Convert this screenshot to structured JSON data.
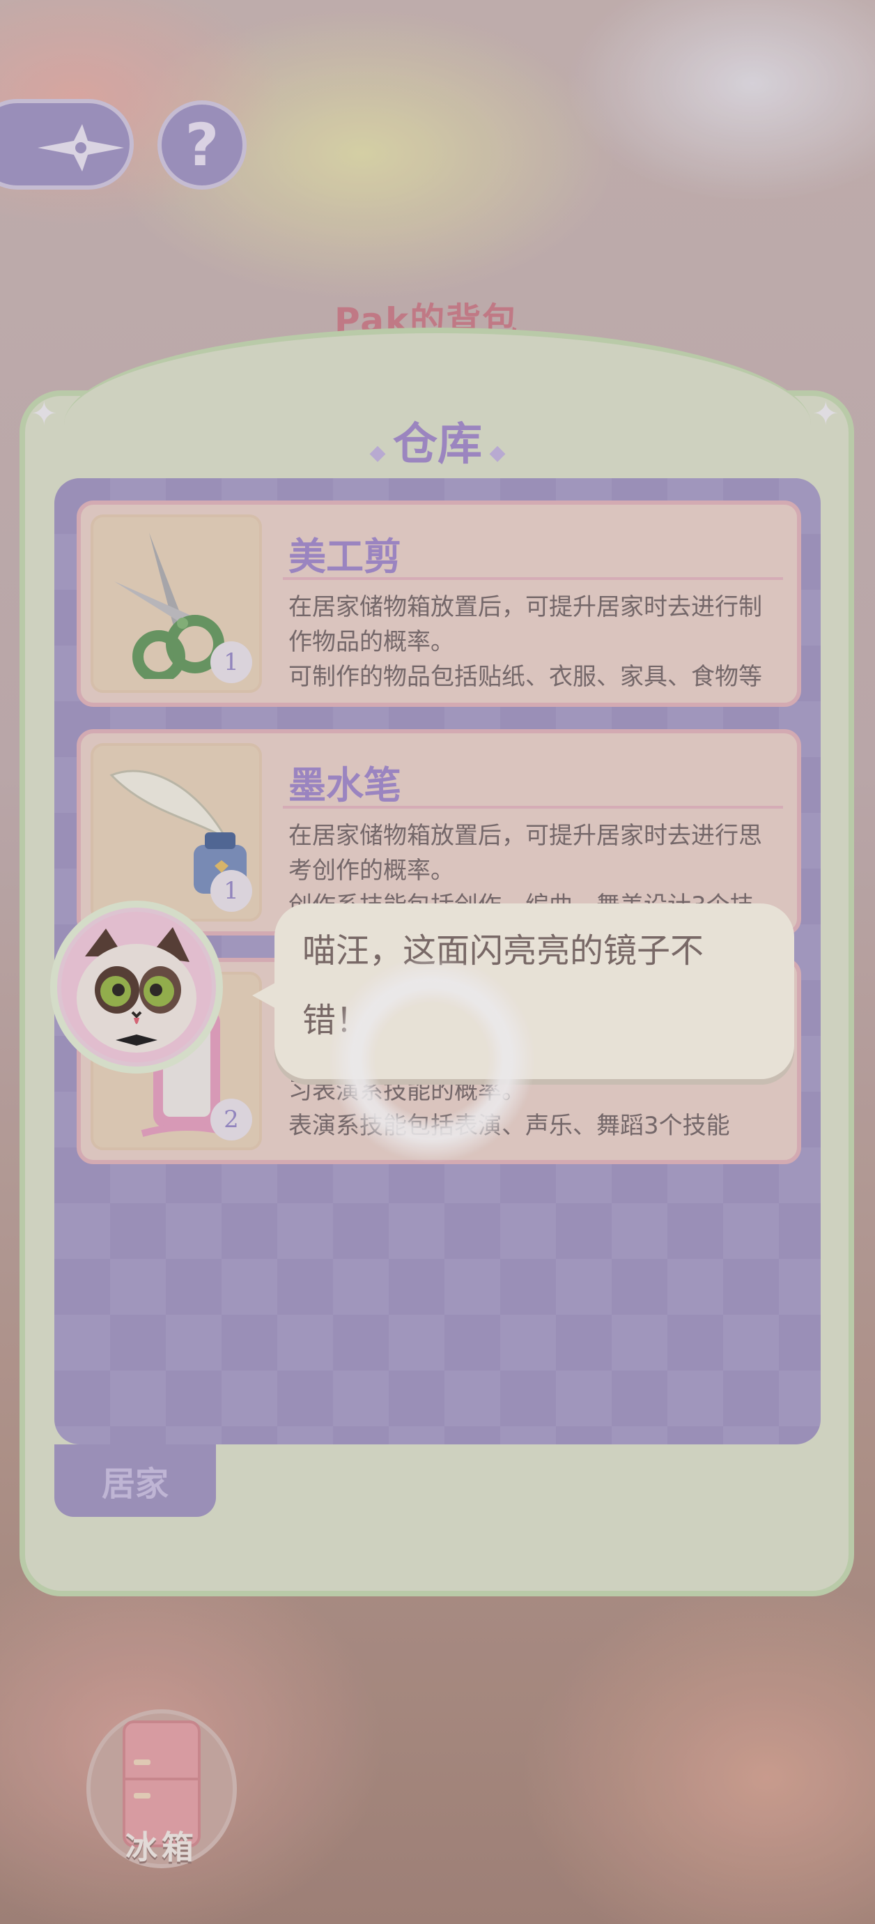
{
  "header": {
    "bag_title": "Pak的背包",
    "help_label": "?"
  },
  "panel": {
    "title": "仓库",
    "tab_label": "居家"
  },
  "items": [
    {
      "name": "美工剪",
      "icon": "scissors-icon",
      "count": "1",
      "desc_lines": [
        "在居家储物箱放置后，可提升居家时去进行制作物品的概率。",
        "可制作的物品包括贴纸、衣服、家具、食物等"
      ]
    },
    {
      "name": "墨水笔",
      "icon": "quill-ink-icon",
      "count": "1",
      "desc_lines": [
        "在居家储物箱放置后，可提升居家时去进行思考创作的概率。",
        "创作系技能包括创作、编曲、舞美设计3个技"
      ]
    },
    {
      "name": "",
      "icon": "mirror-icon",
      "count": "2",
      "desc_lines": [
        "习表演系技能的概率。",
        "表演系技能包括表演、声乐、舞蹈3个技能"
      ]
    }
  ],
  "dialog": {
    "text": "喵汪，这面闪亮亮的镜子不错！",
    "speaker_icon": "cat-avatar-icon"
  },
  "bottom": {
    "fridge_label": "冰箱"
  },
  "colors": {
    "panel": "#dfe5cf",
    "content": "#a59bc6",
    "title": "#a690cf",
    "card": "#ecd6cd"
  }
}
